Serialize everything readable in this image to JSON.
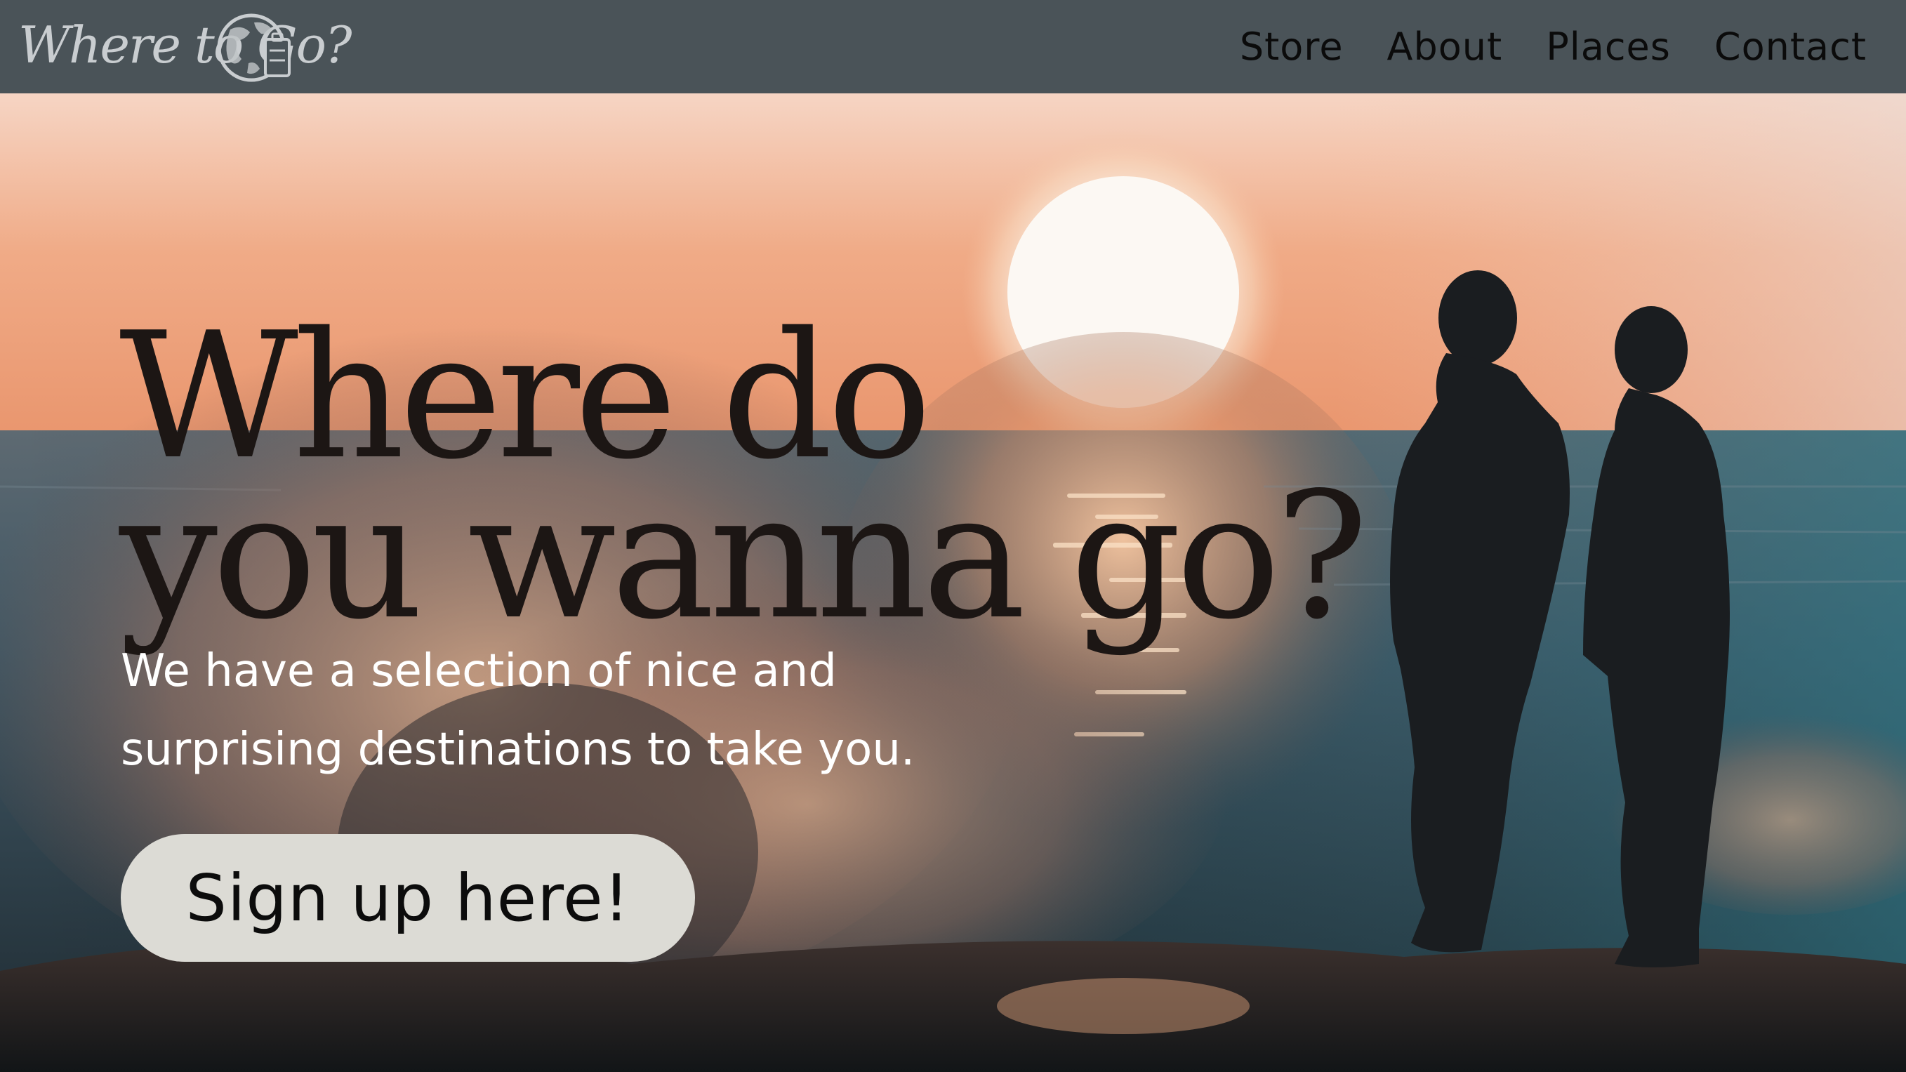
{
  "navbar": {
    "logo_text": "Where to Go?",
    "links": [
      "Store",
      "About",
      "Places",
      "Contact"
    ]
  },
  "hero": {
    "headline_line1": "Where do",
    "headline_line2": "you wanna go?",
    "subtext_line1": "We have a selection of nice and",
    "subtext_line2": "surprising destinations to take you.",
    "cta_label": "Sign up here!"
  },
  "colors": {
    "navbar_bg": "#4a5358",
    "cta_bg": "#dcdbd5",
    "headline": "#1c1614",
    "subtext": "#ffffff"
  },
  "icons": [
    "globe-suitcase-icon"
  ]
}
